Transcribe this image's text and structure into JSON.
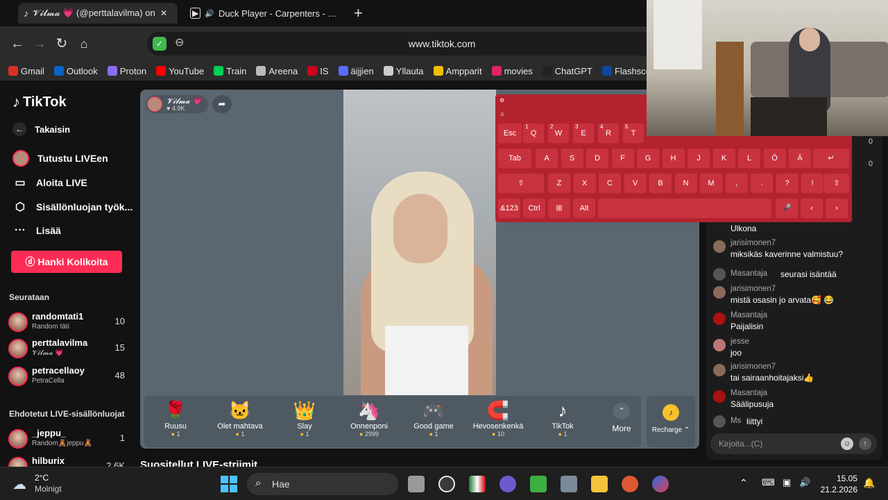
{
  "browser": {
    "tabs": [
      {
        "title": "𝓥𝓲𝓵𝓶𝓪 💗 (@perttalavilma) on",
        "close": "✕"
      },
      {
        "title": "Duck Player - Carpenters - Rain"
      }
    ],
    "new_tab": "+",
    "url": "www.tiktok.com",
    "bookmarks": [
      "Gmail",
      "Outlook",
      "Proton",
      "YouTube",
      "Train",
      "Areena",
      "IS",
      "äijjien",
      "Yllauta",
      "Ampparit",
      "movies",
      "ChatGPT",
      "Flashscor"
    ],
    "bookmark_colors": [
      "#d93025",
      "#0a64c8",
      "#8c6cf2",
      "#ff0000",
      "#00d054",
      "#bbb",
      "#d0021b",
      "#5b6cff",
      "#ccc",
      "#f0c000",
      "#e0245e",
      "#222",
      "#0d47a1"
    ]
  },
  "sidebar": {
    "logo": "TikTok",
    "back": "Takaisin",
    "items": [
      {
        "label": "Tutustu LIVEen",
        "icon": "live-icon"
      },
      {
        "label": "Aloita LIVE",
        "icon": "camera-icon"
      },
      {
        "label": "Sisällönluojan työk...",
        "icon": "creator-tools-icon"
      },
      {
        "label": "Lisää",
        "icon": "more-icon"
      }
    ],
    "coins_button": "Hanki Kolikoita",
    "following_title": "Seurataan",
    "following": [
      {
        "name": "randomtati1",
        "sub": "Random täti",
        "count": "10"
      },
      {
        "name": "perttalavilma",
        "sub": "𝓥𝓲𝓵𝓶𝓪 💗",
        "count": "15"
      },
      {
        "name": "petracellaoy",
        "sub": "PetraCella",
        "count": "48"
      }
    ],
    "suggested_title": "Ehdotetut LIVE-sisällönluojat",
    "suggested": [
      {
        "name": "_jeppu_",
        "sub": "Random🧸jeppu🧸",
        "count": "1"
      },
      {
        "name": "hilburix",
        "sub": "",
        "count": "2.6K"
      }
    ]
  },
  "stream": {
    "host_name": "𝓥𝓲𝓵𝓶𝓪 💗",
    "host_likes": "♥ 4.9K",
    "gifts": [
      {
        "icon": "🌹",
        "name": "Ruusu",
        "price": "1"
      },
      {
        "icon": "🐱",
        "name": "Olet mahtava",
        "price": "1"
      },
      {
        "icon": "👑",
        "name": "Slay",
        "price": "1"
      },
      {
        "icon": "🦄",
        "name": "Onnenponi",
        "price": "2999"
      },
      {
        "icon": "🎮",
        "name": "Good game",
        "price": "1"
      },
      {
        "icon": "🧲",
        "name": "Hevosenkenkä",
        "price": "10"
      },
      {
        "icon": "♪",
        "name": "TikTok",
        "price": "1"
      }
    ],
    "more_label": "More",
    "recharge_label": "Recharge ⌃",
    "recommended_title": "Suositellut LIVE-striimit"
  },
  "chat": {
    "messages": [
      {
        "user": "",
        "text": "Ulkona",
        "inline": false
      },
      {
        "user": "jarisimonen7",
        "text": "miksikäs kaverinne valmistuu?",
        "inline": false
      },
      {
        "user": "Masantaja",
        "text": "seurasi isäntää",
        "inline": true
      },
      {
        "user": "jarisimonen7",
        "text": "mistä osasin jo arvata🥰 😂",
        "inline": false
      },
      {
        "user": "Masantaja",
        "text": "Paijalisin",
        "inline": false
      },
      {
        "user": "jesse",
        "text": "joo",
        "inline": false
      },
      {
        "user": "jarisimonen7",
        "text": "tai sairaanhoitajaksi👍",
        "inline": false
      },
      {
        "user": "Masantaja",
        "text": "Säälipusuja",
        "inline": false
      },
      {
        "user": "Ms",
        "text": "liittyi",
        "inline": true
      }
    ],
    "side_counts": [
      "0",
      "0"
    ],
    "input_placeholder": "Kirjoita...(C)"
  },
  "keyboard": {
    "row1": [
      {
        "k": "Esc"
      },
      {
        "k": "Q",
        "s": "1"
      },
      {
        "k": "W",
        "s": "2"
      },
      {
        "k": "E",
        "s": "3"
      },
      {
        "k": "R",
        "s": "4"
      },
      {
        "k": "T",
        "s": "5"
      }
    ],
    "row2": [
      "Tab",
      "A",
      "S",
      "D",
      "F",
      "G",
      "H",
      "J",
      "K",
      "L",
      "Ö",
      "Ä",
      "↵"
    ],
    "row3": [
      "⇧",
      "Z",
      "X",
      "C",
      "V",
      "B",
      "N",
      "M",
      ",",
      ".",
      "?",
      "!",
      "⇧"
    ],
    "row4": [
      "&123",
      "Ctrl",
      "⊞",
      "Alt",
      "",
      "🎤",
      "‹",
      "›"
    ]
  },
  "taskbar": {
    "temp": "2°C",
    "weather": "Molnigt",
    "search": "Hae",
    "time": "15.05",
    "date": "21.2.2026"
  }
}
